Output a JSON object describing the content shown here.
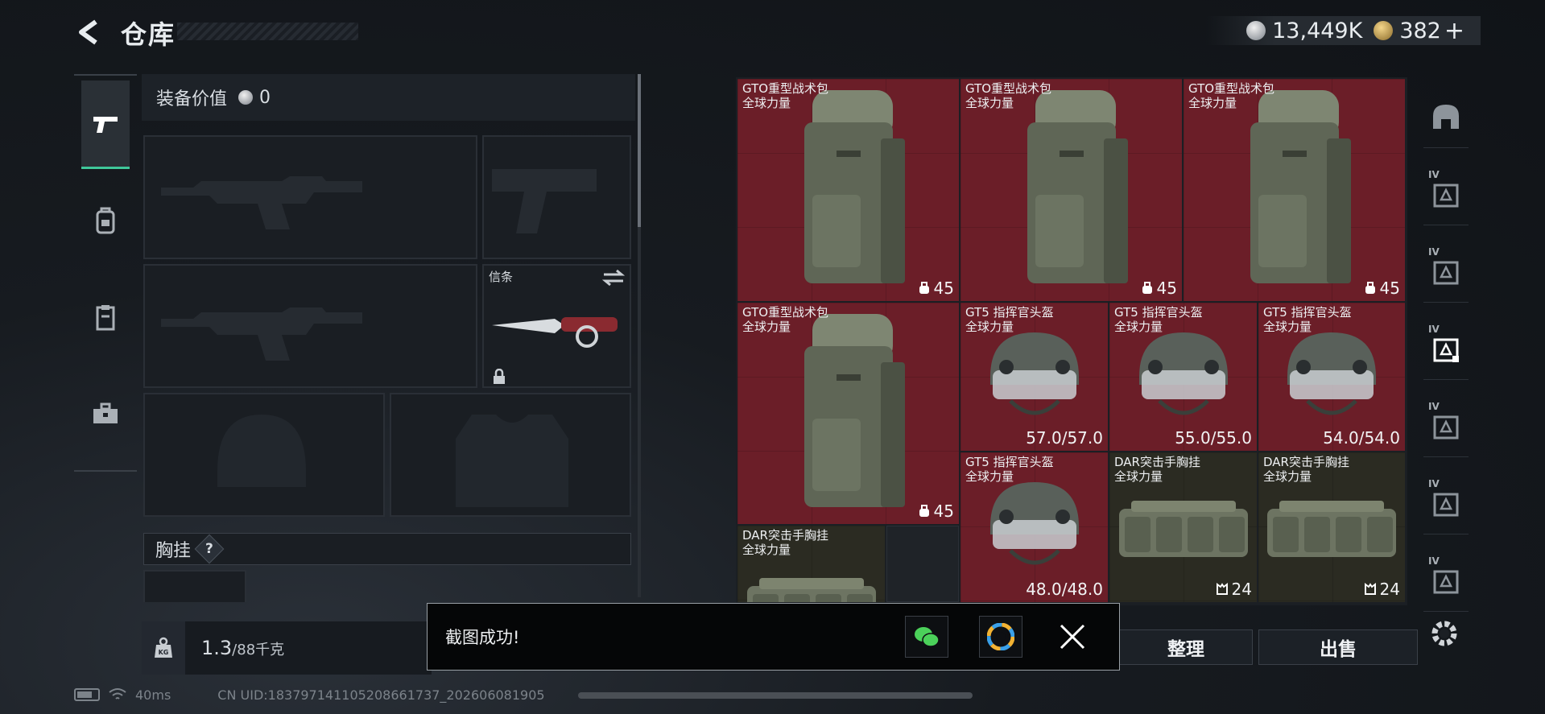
{
  "header": {
    "title": "仓库",
    "currencies": [
      {
        "icon": "silver-coin-icon",
        "value": "13,449K"
      },
      {
        "icon": "gold-coin-icon",
        "value": "382"
      }
    ],
    "add_label": "+"
  },
  "left_tabs": [
    {
      "icon": "pistol-icon",
      "active": true
    },
    {
      "icon": "backpack-icon",
      "active": false
    },
    {
      "icon": "clipboard-icon",
      "active": false
    },
    {
      "icon": "toolbox-icon",
      "active": false
    }
  ],
  "loadout": {
    "value_label": "装备价值",
    "value": "0",
    "melee_label": "信条",
    "chest_label": "胸挂",
    "help_label": "?"
  },
  "weight": {
    "icon_label": "KG",
    "current": "1.3",
    "capacity": "/88千克"
  },
  "inventory": {
    "items": [
      {
        "name": "GTO重型战术包",
        "sub": "全球力量",
        "stat": "45",
        "stat_icon": "capacity-icon",
        "rarity": "red",
        "kind": "backpack"
      },
      {
        "name": "GTO重型战术包",
        "sub": "全球力量",
        "stat": "45",
        "stat_icon": "capacity-icon",
        "rarity": "red",
        "kind": "backpack"
      },
      {
        "name": "GTO重型战术包",
        "sub": "全球力量",
        "stat": "45",
        "stat_icon": "capacity-icon",
        "rarity": "red",
        "kind": "backpack"
      },
      {
        "name": "GTO重型战术包",
        "sub": "全球力量",
        "stat": "45",
        "stat_icon": "capacity-icon",
        "rarity": "red",
        "kind": "backpack"
      },
      {
        "name": "GT5 指挥官头盔",
        "sub": "全球力量",
        "stat": "57.0/57.0",
        "rarity": "red",
        "kind": "helmet"
      },
      {
        "name": "GT5 指挥官头盔",
        "sub": "全球力量",
        "stat": "55.0/55.0",
        "rarity": "red",
        "kind": "helmet"
      },
      {
        "name": "GT5 指挥官头盔",
        "sub": "全球力量",
        "stat": "54.0/54.0",
        "rarity": "red",
        "kind": "helmet"
      },
      {
        "name": "GT5 指挥官头盔",
        "sub": "全球力量",
        "stat": "48.0/48.0",
        "rarity": "red",
        "kind": "helmet"
      },
      {
        "name": "DAR突击手胸挂",
        "sub": "全球力量",
        "stat": "24",
        "stat_icon": "vest-capacity-icon",
        "rarity": "green",
        "kind": "rig"
      },
      {
        "name": "DAR突击手胸挂",
        "sub": "全球力量",
        "stat": "24",
        "stat_icon": "vest-capacity-icon",
        "rarity": "green",
        "kind": "rig"
      },
      {
        "name": "DAR突击手胸挂",
        "sub": "全球力量",
        "stat": "",
        "rarity": "green",
        "kind": "rig"
      }
    ]
  },
  "right_tabs": [
    {
      "icon": "helmet-filter-icon",
      "tier": ""
    },
    {
      "icon": "storage-filter-icon",
      "tier": "IV"
    },
    {
      "icon": "backpack-filter-icon",
      "tier": "IV"
    },
    {
      "icon": "chest-rig-filter-icon",
      "tier": "IV"
    },
    {
      "icon": "armor-filter-icon",
      "tier": "IV"
    },
    {
      "icon": "medical-filter-icon",
      "tier": "IV"
    },
    {
      "icon": "misc-filter-icon",
      "tier": "IV"
    }
  ],
  "actions": {
    "sort_label": "整理",
    "sell_label": "出售"
  },
  "toast": {
    "message": "截图成功!",
    "share_options": [
      "wechat-icon",
      "photos-app-icon"
    ]
  },
  "status": {
    "ping": "40ms",
    "uid": "CN UID:18379714110520866173​7_202606081905"
  },
  "colors": {
    "accent": "#3fc79a",
    "rarity_red": "#6b1e28",
    "rarity_green": "#2b2b22"
  }
}
